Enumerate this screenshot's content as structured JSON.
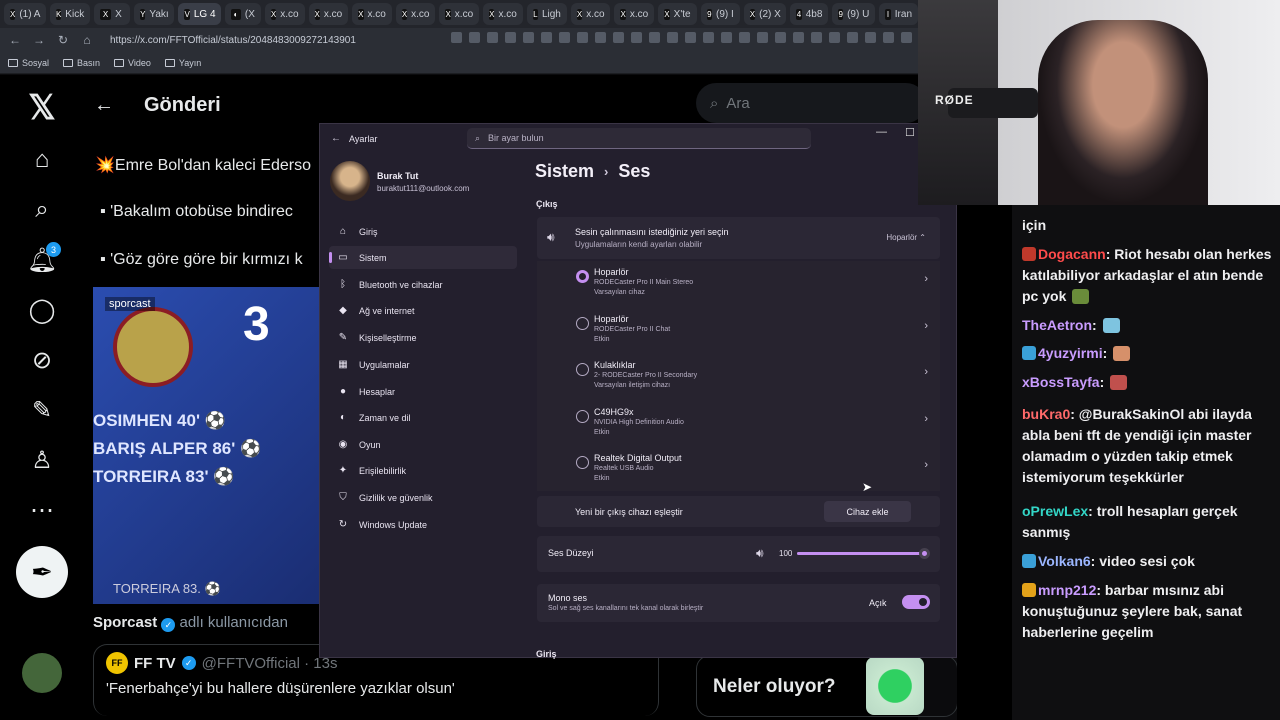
{
  "browser": {
    "tabs": [
      {
        "icon": "X",
        "label": "(1) A"
      },
      {
        "icon": "K",
        "label": "Kick"
      },
      {
        "icon": "X",
        "label": "X"
      },
      {
        "icon": "Y",
        "label": "Yakı"
      },
      {
        "icon": "V",
        "label": "LG 4"
      },
      {
        "icon": "◐",
        "label": "(X"
      },
      {
        "icon": "X",
        "label": "x.co"
      },
      {
        "icon": "X",
        "label": "x.co"
      },
      {
        "icon": "X",
        "label": "x.co"
      },
      {
        "icon": "X",
        "label": "x.co"
      },
      {
        "icon": "X",
        "label": "x.co"
      },
      {
        "icon": "X",
        "label": "x.co"
      },
      {
        "icon": "L",
        "label": "Ligh"
      },
      {
        "icon": "X",
        "label": "x.co"
      },
      {
        "icon": "X",
        "label": "x.co"
      },
      {
        "icon": "X",
        "label": "X'te"
      },
      {
        "icon": "9",
        "label": "(9) I"
      },
      {
        "icon": "X",
        "label": "(2) X"
      },
      {
        "icon": "4",
        "label": "4b8"
      },
      {
        "icon": "9",
        "label": "(9) U"
      },
      {
        "icon": "I",
        "label": "Iran"
      }
    ],
    "url": "https://x.com/FFTOfficial/status/2048483009272143901",
    "bookmarks": [
      "Sosyal",
      "Basın",
      "Video",
      "Yayın"
    ]
  },
  "x": {
    "header_title": "Gönderi",
    "notif_count": "3",
    "handle_partial": "@FFTOfficial",
    "tweet_line1": "💥Emre Bol'dan kaleci Ederso",
    "tweet_line2": "'Bakalım otobüse bindirec",
    "tweet_line3": "'Göz göre göre bir kırmızı k",
    "image": {
      "tag": "sporcast",
      "number": "3",
      "rows": [
        "OSIMHEN 40' ⚽",
        "BARIŞ ALPER 86' ⚽",
        "TORREIRA 83' ⚽"
      ],
      "bottom": "TORREIRA  83. ⚽"
    },
    "source_name": "Sporcast",
    "source_suffix": "adlı kullanıcıdan",
    "quote_name": "FF TV",
    "quote_handle": "@FFTVOfficial · 13s",
    "quote_text": "'Fenerbahçe'yi bu hallere düşürenlere yazıklar olsun'",
    "search_placeholder": "Ara",
    "trending_title": "Neler oluyor?"
  },
  "settings": {
    "window_title": "Ayarlar",
    "search_placeholder": "Bir ayar bulun",
    "profile_name": "Burak Tut",
    "profile_email": "buraktut111@outlook.com",
    "nav": [
      {
        "label": "Giriş",
        "icon": "home-icon",
        "glyph": "⌂"
      },
      {
        "label": "Sistem",
        "icon": "system-icon",
        "glyph": "▭"
      },
      {
        "label": "Bluetooth ve cihazlar",
        "icon": "bluetooth-icon",
        "glyph": "ᛒ"
      },
      {
        "label": "Ağ ve internet",
        "icon": "network-icon",
        "glyph": "◆"
      },
      {
        "label": "Kişiselleştirme",
        "icon": "brush-icon",
        "glyph": "✎"
      },
      {
        "label": "Uygulamalar",
        "icon": "apps-icon",
        "glyph": "▦"
      },
      {
        "label": "Hesaplar",
        "icon": "account-icon",
        "glyph": "●"
      },
      {
        "label": "Zaman ve dil",
        "icon": "globe-icon",
        "glyph": "◐"
      },
      {
        "label": "Oyun",
        "icon": "gamepad-icon",
        "glyph": "◉"
      },
      {
        "label": "Erişilebilirlik",
        "icon": "accessibility-icon",
        "glyph": "✦"
      },
      {
        "label": "Gizlilik ve güvenlik",
        "icon": "shield-icon",
        "glyph": "⛉"
      },
      {
        "label": "Windows Update",
        "icon": "update-icon",
        "glyph": "↻"
      }
    ],
    "crumb_parent": "Sistem",
    "crumb_current": "Ses",
    "output_heading": "Çıkış",
    "output_title": "Sesin çalınmasını istediğiniz yeri seçin",
    "output_sub": "Uygulamaların kendi ayarları olabilir",
    "output_selected": "Hoparlör",
    "devices": [
      {
        "name": "Hoparlör",
        "desc1": "RODECaster Pro II Main Stereo",
        "desc2": "Varsayılan cihaz",
        "selected": true
      },
      {
        "name": "Hoparlör",
        "desc1": "RODECaster Pro II Chat",
        "desc2": "Etkin",
        "selected": false
      },
      {
        "name": "Kulaklıklar",
        "desc1": "2- RODECaster Pro II Secondary",
        "desc2": "Varsayılan iletişim cihazı",
        "selected": false
      },
      {
        "name": "C49HG9x",
        "desc1": "NVIDIA High Definition Audio",
        "desc2": "Etkin",
        "selected": false
      },
      {
        "name": "Realtek Digital Output",
        "desc1": "Realtek USB Audio",
        "desc2": "Etkin",
        "selected": false
      }
    ],
    "pair_label": "Yeni bir çıkış cihazı eşleştir",
    "pair_button": "Cihaz ekle",
    "volume_label": "Ses Düzeyi",
    "volume_value": "100",
    "volume_level": 1.0,
    "mono_title": "Mono ses",
    "mono_desc": "Sol ve sağ ses kanallarını tek kanal olarak birleştir",
    "mono_state": "Açık",
    "input_heading": "Giriş",
    "accent": "#c48ff0"
  },
  "stream": {
    "cam_brand": "RØDE",
    "chat": [
      {
        "user": "",
        "text": "için",
        "color": "#efeff1"
      },
      {
        "user": "Dogacann",
        "text": "Riot hesabı olan herkes katılabiliyor arkadaşlar el atın bende pc yok",
        "color": "#ff4b4b",
        "badge": "#c0392b",
        "emote": "#6a8c3a"
      },
      {
        "user": "TheAetron",
        "text": "",
        "color": "#c99cff",
        "emote": "#7ec4e0"
      },
      {
        "user": "4yuzyirmi",
        "text": "",
        "color": "#c99cff",
        "badge": "#3aa0d8",
        "emote": "#d6906a"
      },
      {
        "user": "xBossTayfa",
        "text": "",
        "color": "#c99cff",
        "emote": "#c0504d"
      },
      {
        "user": "buKra0",
        "text": "@BurakSakinOl abi ilayda abla beni tft de yendiği için master olamadım o yüzden takip etmek istemiyorum teşekkürler",
        "color": "#ff6a6a"
      },
      {
        "user": "oPrewLex",
        "text": "troll hesapları gerçek sanmış",
        "color": "#33d6c7"
      },
      {
        "user": "Volkan6",
        "text": "video sesi çok",
        "color": "#9bb6ff",
        "badge": "#3aa0d8"
      },
      {
        "user": "mrnp212",
        "text": "barbar mısınız abi konuştuğunuz şeylere bak, sanat haberlerine geçelim",
        "color": "#c99cff",
        "badge": "#e3a21a"
      }
    ]
  }
}
